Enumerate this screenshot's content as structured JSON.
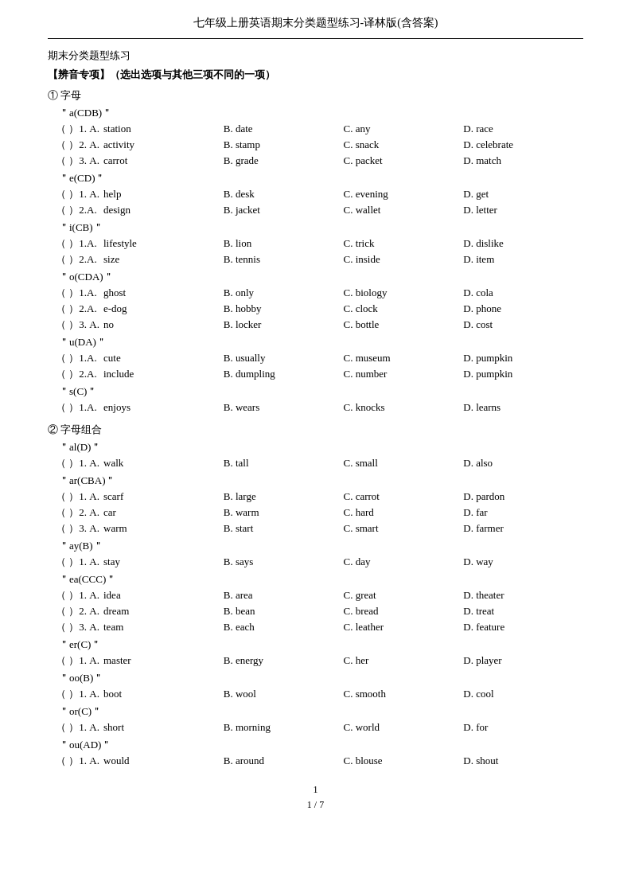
{
  "title": "七年级上册英语期末分类题型练习-译林版(含答案)",
  "section_title": "期末分类题型练习",
  "section_header": "【辨音专项】（选出选项与其他三项不同的一项）",
  "subsection1": {
    "label": "①  字母",
    "patterns": [
      {
        "label": "＂a(CDB)＂",
        "questions": [
          {
            "num": "（    ）1. A.",
            "A": "station",
            "B": "B. date",
            "C": "C. any",
            "D": "D. race"
          },
          {
            "num": "（    ）2. A.",
            "A": "activity",
            "B": "B. stamp",
            "C": "C. snack",
            "D": "D. celebrate"
          },
          {
            "num": "（    ）3. A.",
            "A": "carrot",
            "B": "B. grade",
            "C": "C. packet",
            "D": "D. match"
          }
        ]
      },
      {
        "label": "＂e(CD)＂",
        "questions": [
          {
            "num": "（    ）1. A.",
            "A": "help",
            "B": "B. desk",
            "C": "C. evening",
            "D": "D. get"
          },
          {
            "num": "（    ）2.A.",
            "A": "design",
            "B": "B. jacket",
            "C": "C. wallet",
            "D": "D. letter"
          }
        ]
      },
      {
        "label": "＂i(CB)＂",
        "questions": [
          {
            "num": "（      ）1.A.",
            "A": "lifestyle",
            "B": "B. lion",
            "C": "C. trick",
            "D": "D. dislike"
          },
          {
            "num": "（    ）2.A.",
            "A": "size",
            "B": "B. tennis",
            "C": "C. inside",
            "D": "D. item"
          }
        ]
      },
      {
        "label": "＂o(CDA)＂",
        "questions": [
          {
            "num": "（      ）1.A.",
            "A": "ghost",
            "B": "B. only",
            "C": "C. biology",
            "D": "D. cola"
          },
          {
            "num": "（      ）2.A.",
            "A": "e-dog",
            "B": "B. hobby",
            "C": "C. clock",
            "D": "D. phone"
          },
          {
            "num": "（    ）3. A.",
            "A": "no",
            "B": "B. locker",
            "C": "C. bottle",
            "D": "D. cost"
          }
        ]
      },
      {
        "label": "＂u(DA)＂",
        "questions": [
          {
            "num": "（    ）1.A.",
            "A": "cute",
            "B": "B. usually",
            "C": "C. museum",
            "D": "D. pumpkin"
          },
          {
            "num": "（    ）2.A.",
            "A": "include",
            "B": "B. dumpling",
            "C": "C. number",
            "D": "D. pumpkin"
          }
        ]
      },
      {
        "label": "＂s(C)＂",
        "questions": [
          {
            "num": "（    ）1.A.",
            "A": "enjoys",
            "B": "B. wears",
            "C": "C. knocks",
            "D": "D. learns"
          }
        ]
      }
    ]
  },
  "subsection2": {
    "label": "②  字母组合",
    "patterns": [
      {
        "label": "＂al(D)＂",
        "questions": [
          {
            "num": "（      ）1. A.",
            "A": "walk",
            "B": "B. tall",
            "C": "C. small",
            "D": "D. also"
          }
        ]
      },
      {
        "label": "＂ar(CBA)＂",
        "questions": [
          {
            "num": "（    ）1. A.",
            "A": "scarf",
            "B": "B. large",
            "C": "C. carrot",
            "D": "D. pardon"
          },
          {
            "num": "（    ）2. A.",
            "A": "car",
            "B": "B. warm",
            "C": "C. hard",
            "D": "D. far"
          },
          {
            "num": "（    ）3. A.",
            "A": "warm",
            "B": "B. start",
            "C": "C. smart",
            "D": "D. farmer"
          }
        ]
      },
      {
        "label": "＂ay(B)＂",
        "questions": [
          {
            "num": "（    ）1. A.",
            "A": "stay",
            "B": "B. says",
            "C": "C. day",
            "D": "D. way"
          }
        ]
      },
      {
        "label": "＂ea(CCC)＂",
        "questions": [
          {
            "num": "（    ）1. A.",
            "A": "idea",
            "B": "B. area",
            "C": "C. great",
            "D": "D. theater"
          },
          {
            "num": "（    ）2. A.",
            "A": "dream",
            "B": "B. bean",
            "C": "C. bread",
            "D": "D. treat"
          },
          {
            "num": "（    ）3. A.",
            "A": "team",
            "B": "B. each",
            "C": "C. leather",
            "D": "D. feature"
          }
        ]
      },
      {
        "label": "＂er(C)＂",
        "questions": [
          {
            "num": "（    ）1. A.",
            "A": "master",
            "B": "B. energy",
            "C": "C. her",
            "D": "D. player"
          }
        ]
      },
      {
        "label": "＂oo(B)＂",
        "questions": [
          {
            "num": "（    ）1. A.",
            "A": "boot",
            "B": "B. wool",
            "C": "C. smooth",
            "D": "D. cool"
          }
        ]
      },
      {
        "label": "＂or(C)＂",
        "questions": [
          {
            "num": "（    ）1. A.",
            "A": "short",
            "B": "B. morning",
            "C": "C. world",
            "D": "D. for"
          }
        ]
      },
      {
        "label": "＂ou(AD)＂",
        "questions": [
          {
            "num": "（    ）1. A.",
            "A": "would",
            "B": "B. around",
            "C": "C. blouse",
            "D": "D. shout"
          }
        ]
      }
    ]
  },
  "page_number": "1",
  "page_fraction": "1 / 7"
}
